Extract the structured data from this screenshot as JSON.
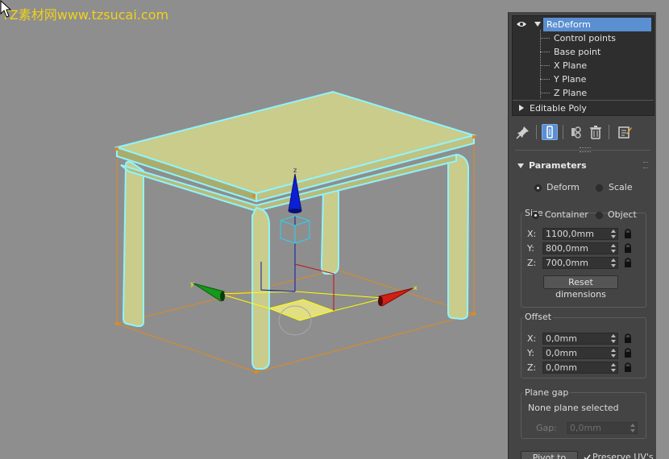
{
  "watermark": "TZ素材网www.tzsucai.com",
  "modifier_stack": {
    "items": [
      {
        "label": "ReDeform",
        "selected": true
      },
      {
        "label": "Control points"
      },
      {
        "label": "Base point"
      },
      {
        "label": "X Plane"
      },
      {
        "label": "Y Plane"
      },
      {
        "label": "Z Plane"
      },
      {
        "label": "Editable Poly"
      }
    ]
  },
  "toolbar": {
    "icons": [
      "pin-stack-icon",
      "show-end-result-icon",
      "make-unique-icon",
      "remove-modifier-icon",
      "configure-modifier-sets-icon"
    ]
  },
  "parameters": {
    "title": "Parameters",
    "mode": {
      "deform": "Deform",
      "scale": "Scale",
      "selected": "Deform"
    },
    "size": {
      "group": "Size",
      "container": "Container",
      "object": "Object",
      "selected": "Container",
      "x_label": "X:",
      "x_value": "1100,0mm",
      "y_label": "Y:",
      "y_value": "800,0mm",
      "z_label": "Z:",
      "z_value": "700,0mm",
      "reset": "Reset dimensions"
    },
    "offset": {
      "group": "Offset",
      "x_label": "X:",
      "x_value": "0,0mm",
      "y_label": "Y:",
      "y_value": "0,0mm",
      "z_label": "Z:",
      "z_value": "0,0mm"
    },
    "plane_gap": {
      "group": "Plane gap",
      "status": "None plane selected",
      "gap_label": "Gap:",
      "gap_value": "0,0mm"
    },
    "pivot_button": "Pivot to base",
    "preserve_uv": "Preserve UV's",
    "preserve_uv_checked": true
  },
  "gizmo": {
    "x_label": "x",
    "y_label": "y",
    "z_label": "z"
  },
  "colors": {
    "selection": "#5a8fd1",
    "watermark": "#f0d21a",
    "table": "#c9cc8a",
    "outline": "#8ff4ff",
    "bbox": "#e08a1e"
  }
}
